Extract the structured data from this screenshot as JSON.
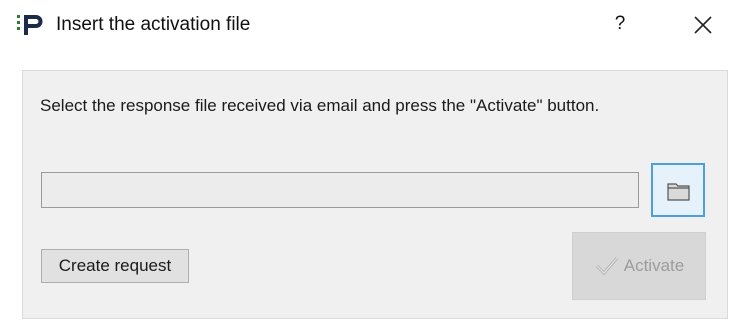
{
  "window": {
    "title": "Insert the activation file",
    "help_label": "?",
    "icons": {
      "app": "app-logo-icon",
      "close": "close-icon"
    }
  },
  "content": {
    "instruction": "Select the response file received via email and press the \"Activate\" button.",
    "file_path_value": "",
    "browse_icon": "folder-icon",
    "create_request_label": "Create request",
    "activate_label": "Activate",
    "activate_icon": "checkmark-icon",
    "activate_enabled": false
  },
  "colors": {
    "accent_border": "#4a9fdc",
    "panel_bg": "#f0f0f0",
    "disabled_text": "#9c9c9c"
  }
}
